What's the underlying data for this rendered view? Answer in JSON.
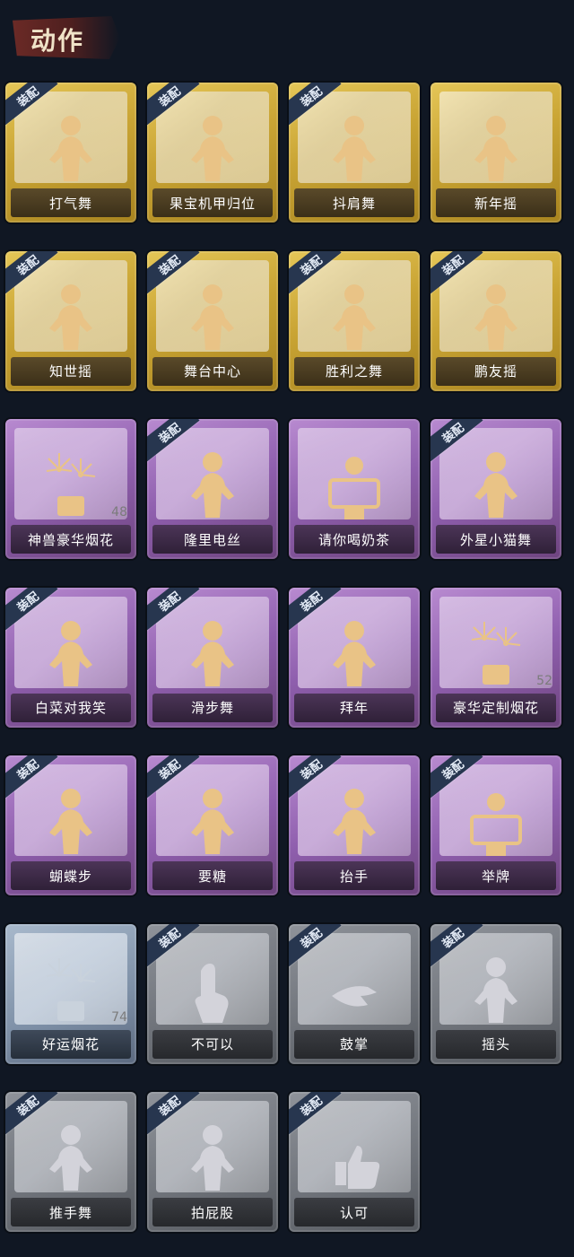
{
  "header": {
    "title": "动作"
  },
  "equip_badge": "装配",
  "colors": {
    "gold": "#d4af3a",
    "purple": "#9a6ab8",
    "blue": "#8a9cb3",
    "silver": "#7b7f86",
    "background": "#101723"
  },
  "cards": [
    {
      "label": "打气舞",
      "tier": "gold",
      "equipped": true,
      "icon": "dance-figure-icon"
    },
    {
      "label": "果宝机甲归位",
      "tier": "gold",
      "equipped": true,
      "icon": "dance-figure-icon"
    },
    {
      "label": "抖肩舞",
      "tier": "gold",
      "equipped": true,
      "icon": "dance-figure-icon"
    },
    {
      "label": "新年摇",
      "tier": "gold",
      "equipped": false,
      "icon": "dance-figure-icon"
    },
    {
      "label": "知世摇",
      "tier": "gold",
      "equipped": true,
      "icon": "dance-figure-icon"
    },
    {
      "label": "舞台中心",
      "tier": "gold",
      "equipped": true,
      "icon": "dance-figure-icon"
    },
    {
      "label": "胜利之舞",
      "tier": "gold",
      "equipped": true,
      "icon": "dance-figure-icon"
    },
    {
      "label": "鹏友摇",
      "tier": "gold",
      "equipped": true,
      "icon": "dance-figure-icon"
    },
    {
      "label": "神兽豪华烟花",
      "tier": "purple",
      "equipped": false,
      "icon": "fireworks-icon",
      "count": "48"
    },
    {
      "label": "隆里电丝",
      "tier": "purple",
      "equipped": true,
      "icon": "dance-figure-icon"
    },
    {
      "label": "请你喝奶茶",
      "tier": "purple",
      "equipped": false,
      "icon": "milk-tea-sign-icon"
    },
    {
      "label": "外星小猫舞",
      "tier": "purple",
      "equipped": true,
      "icon": "dance-figure-icon"
    },
    {
      "label": "白菜对我笑",
      "tier": "purple",
      "equipped": true,
      "icon": "dance-figure-icon"
    },
    {
      "label": "滑步舞",
      "tier": "purple",
      "equipped": true,
      "icon": "dance-figure-icon"
    },
    {
      "label": "拜年",
      "tier": "purple",
      "equipped": true,
      "icon": "dance-figure-icon"
    },
    {
      "label": "豪华定制烟花",
      "tier": "purple",
      "equipped": false,
      "icon": "fireworks-icon",
      "count": "52"
    },
    {
      "label": "蝴蝶步",
      "tier": "purple",
      "equipped": true,
      "icon": "dance-figure-icon"
    },
    {
      "label": "要糖",
      "tier": "purple",
      "equipped": true,
      "icon": "dance-figure-icon"
    },
    {
      "label": "抬手",
      "tier": "purple",
      "equipped": true,
      "icon": "dance-figure-icon"
    },
    {
      "label": "举牌",
      "tier": "purple",
      "equipped": true,
      "icon": "sign-holding-icon"
    },
    {
      "label": "好运烟花",
      "tier": "blue",
      "equipped": false,
      "icon": "fireworks-icon",
      "count": "74"
    },
    {
      "label": "不可以",
      "tier": "silver",
      "equipped": true,
      "icon": "finger-wag-icon"
    },
    {
      "label": "鼓掌",
      "tier": "silver",
      "equipped": true,
      "icon": "clapping-hands-icon"
    },
    {
      "label": "摇头",
      "tier": "silver",
      "equipped": true,
      "icon": "dance-figure-icon"
    },
    {
      "label": "推手舞",
      "tier": "silver",
      "equipped": true,
      "icon": "dance-figure-icon"
    },
    {
      "label": "拍屁股",
      "tier": "silver",
      "equipped": true,
      "icon": "dance-figure-icon"
    },
    {
      "label": "认可",
      "tier": "silver",
      "equipped": true,
      "icon": "thumbs-up-icon"
    }
  ]
}
